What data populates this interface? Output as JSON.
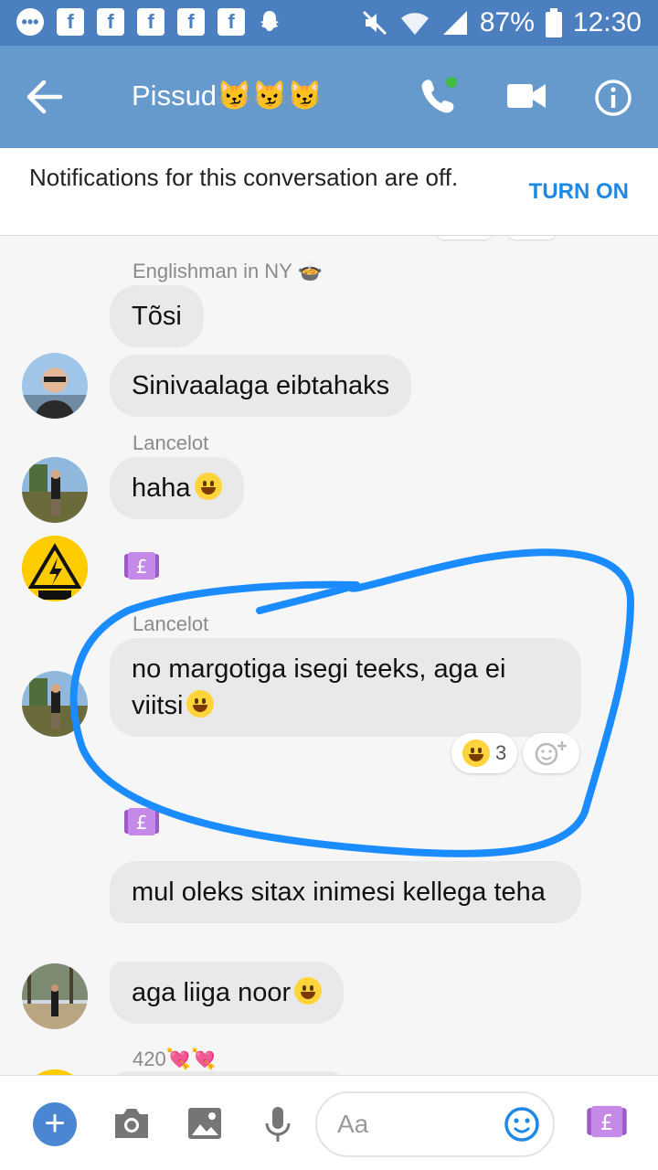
{
  "status_bar": {
    "battery": "87%",
    "time": "12:30",
    "icons": [
      "messages-icon",
      "facebook-icon",
      "facebook-icon",
      "facebook-icon",
      "facebook-icon",
      "facebook-icon",
      "snapchat-icon",
      "mute-icon",
      "wifi-icon",
      "signal-icon",
      "battery-icon"
    ]
  },
  "header": {
    "title": "Pissud",
    "title_emoji": "😼😼😼",
    "active_dot_color": "#44bb44"
  },
  "notification": {
    "text": "Notifications for this conversation are off.",
    "button": "TURN ON"
  },
  "messages": [
    {
      "sender": "Englishman in NY",
      "sender_emoji": "🍲",
      "text": "Tõsi"
    },
    {
      "text": "Sinivaalaga eibtahaks"
    },
    {
      "sender": "Lancelot",
      "text": "haha"
    },
    {
      "sender": "Lancelot",
      "text": "no margotiga isegi teeks, aga ei viitsi",
      "reaction_count": "3"
    },
    {
      "text": "mul oleks sitax inimesi kellega teha"
    },
    {
      "text": "aga liiga noor"
    }
  ],
  "last_sender": {
    "sender": "420",
    "sender_emoji": "💘💘"
  },
  "composer": {
    "placeholder": "Aa"
  },
  "colors": {
    "header": "#6699cc",
    "status_bar": "#4b7fbf",
    "accent": "#1e88e5",
    "annotation": "#1a8cff"
  }
}
